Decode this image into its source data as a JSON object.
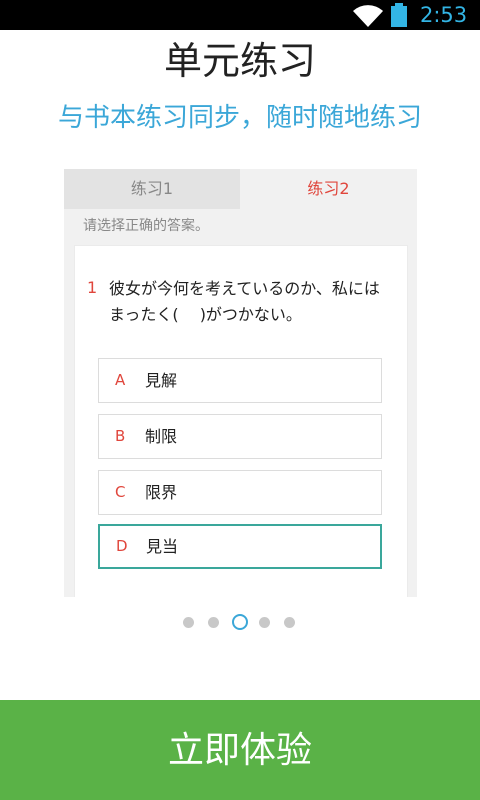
{
  "status_bar": {
    "time": "2:53",
    "wifi_icon": "wifi-icon",
    "battery_icon": "battery-icon",
    "accent": "#33b5e5"
  },
  "title": "单元练习",
  "subtitle": "与书本练习同步，随时随地练习",
  "preview": {
    "tabs": [
      {
        "label": "练习1",
        "selected": false
      },
      {
        "label": "练习2",
        "selected": true
      }
    ],
    "instruction": "请选择正确的答案。",
    "question": {
      "number": "1",
      "text": "彼女が今何を考えているのか、私にはまったく(　 )がつかない。"
    },
    "options": [
      {
        "letter": "A",
        "text": "見解",
        "selected": false
      },
      {
        "letter": "B",
        "text": "制限",
        "selected": false
      },
      {
        "letter": "C",
        "text": "限界",
        "selected": false
      },
      {
        "letter": "D",
        "text": "見当",
        "selected": true
      }
    ]
  },
  "pager": {
    "count": 5,
    "current": 3
  },
  "cta": {
    "label": "立即体验",
    "color": "#5ab247"
  }
}
